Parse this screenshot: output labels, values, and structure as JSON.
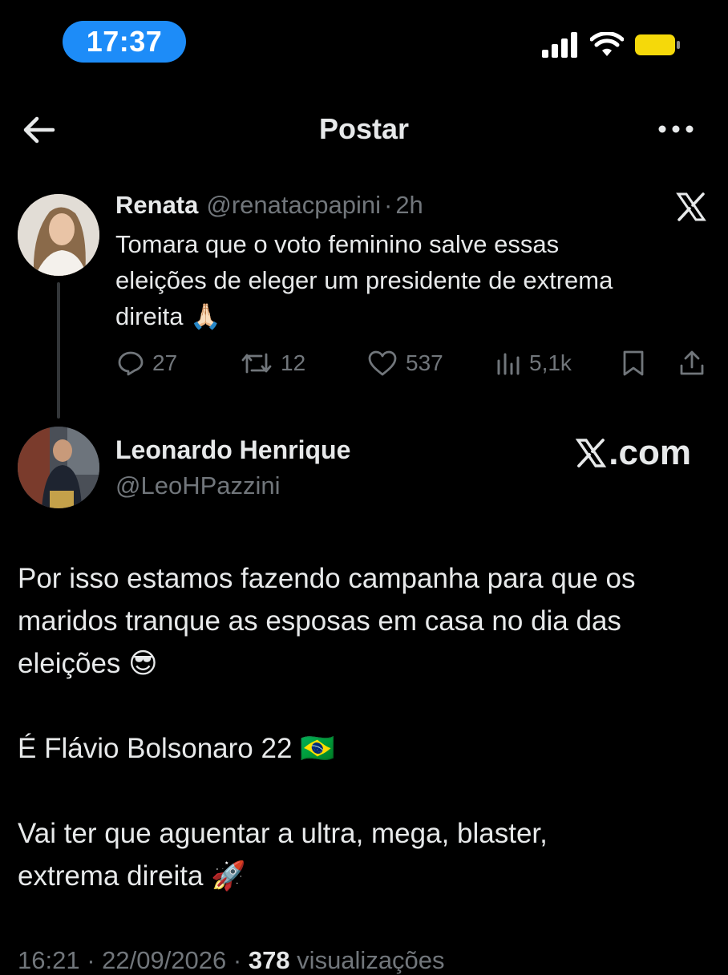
{
  "status_bar": {
    "time": "17:37"
  },
  "header": {
    "title": "Postar"
  },
  "tweet1": {
    "name": "Renata",
    "handle": "@renatacpapini",
    "separator": "·",
    "age": "2h",
    "text_line1": "Tomara que o voto feminino salve essas",
    "text_line2": "eleições de eleger um presidente de extrema",
    "text_line3": "direita 🙏🏻",
    "replies": "27",
    "reposts": "12",
    "likes": "537",
    "views": "5,1k"
  },
  "tweet2": {
    "name": "Leonardo Henrique",
    "handle": "@LeoHPazzini",
    "brand_suffix": ".com",
    "line1": "Por isso estamos fazendo campanha para que os",
    "line2": "maridos tranque as esposas em casa no dia das",
    "line3": "eleições 😎",
    "line4": "É Flávio Bolsonaro 22 🇧🇷",
    "line5": "Vai ter que aguentar a ultra, mega, blaster,",
    "line6": "extrema direita 🚀",
    "footer_time": "16:21 · 22/09/2026 · ",
    "footer_views_count": "378",
    "footer_views_label": " visualizações"
  },
  "colors": {
    "accent": "#1d8cf8",
    "muted": "#71767b",
    "text": "#e7e9ea",
    "background": "#000000",
    "battery": "#f5d90a"
  },
  "icons": [
    "back-arrow-icon",
    "more-icon",
    "x-logo-icon",
    "reply-icon",
    "repost-icon",
    "like-icon",
    "views-icon",
    "bookmark-icon",
    "share-icon",
    "signal-icon",
    "wifi-icon",
    "battery-icon"
  ]
}
